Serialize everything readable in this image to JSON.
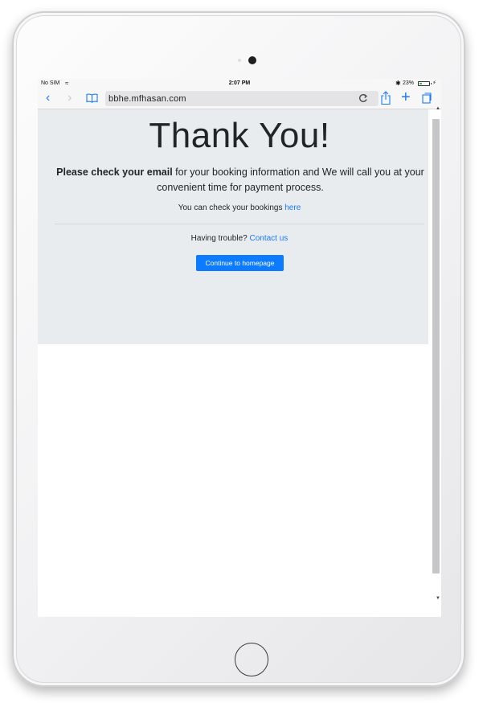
{
  "statusbar": {
    "carrier": "No SIM",
    "time": "2:07 PM",
    "battery": "23%",
    "battery_color": "#3cc13b"
  },
  "browser": {
    "url": "bbhe.mfhasan.com",
    "icons": {
      "back": "chevron-left-icon",
      "forward": "chevron-right-icon",
      "bookmarks": "book-icon",
      "reload": "reload-icon",
      "share": "share-icon",
      "new_tab": "plus-icon",
      "tabs": "tabs-icon"
    },
    "accent_color": "#1a7af8"
  },
  "page": {
    "title": "Thank You!",
    "lead_strong": "Please check your email",
    "lead_rest": " for your booking information and We will call you at your convenient time for payment process.",
    "bookings_text": "You can check your bookings ",
    "bookings_link": "here",
    "trouble_text": "Having trouble? ",
    "contact_link": "Contact us",
    "home_button": "Continue to homepage",
    "jumbotron_color": "#e9ecef",
    "button_color": "#0d7bff"
  }
}
